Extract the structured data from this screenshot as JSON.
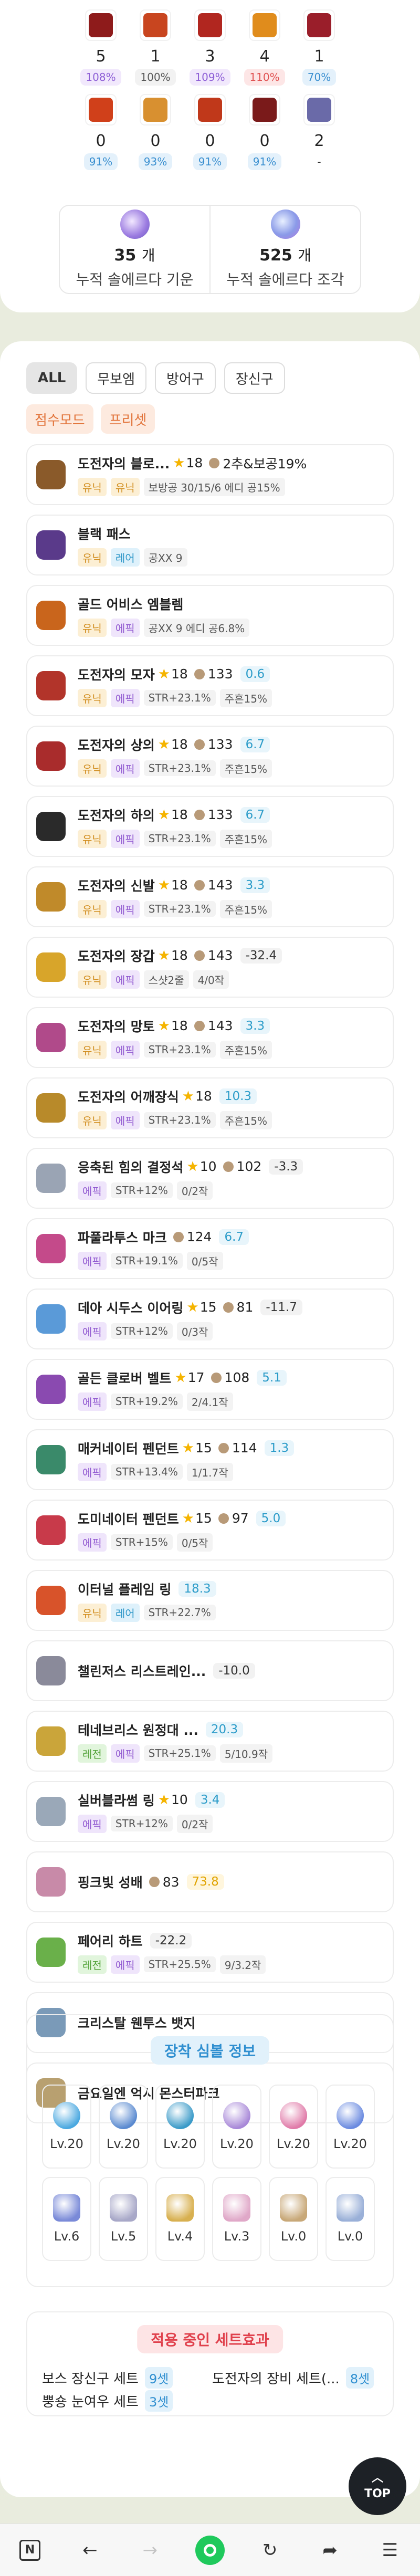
{
  "stats": [
    {
      "count": "5",
      "pct": "108%",
      "pct_color": "#8e5fd6",
      "pct_bg": "#f1e8fc",
      "icon_color": "#8e1b1b"
    },
    {
      "count": "1",
      "pct": "100%",
      "pct_color": "#555555",
      "pct_bg": "#f2f2f2",
      "icon_color": "#c8451f"
    },
    {
      "count": "3",
      "pct": "109%",
      "pct_color": "#8e5fd6",
      "pct_bg": "#f1e8fc",
      "icon_color": "#b1261f"
    },
    {
      "count": "4",
      "pct": "110%",
      "pct_color": "#e05050",
      "pct_bg": "#fde6e6",
      "icon_color": "#e08c1c"
    },
    {
      "count": "1",
      "pct": "70%",
      "pct_color": "#3a8fd0",
      "pct_bg": "#e4f1fb",
      "icon_color": "#9a1e2a"
    },
    {
      "count": "0",
      "pct": "91%",
      "pct_color": "#3a8fd0",
      "pct_bg": "#e4f1fb",
      "icon_color": "#d0401a"
    },
    {
      "count": "0",
      "pct": "93%",
      "pct_color": "#3a8fd0",
      "pct_bg": "#e4f1fb",
      "icon_color": "#d89030"
    },
    {
      "count": "0",
      "pct": "91%",
      "pct_color": "#3a8fd0",
      "pct_bg": "#e4f1fb",
      "icon_color": "#c0381a"
    },
    {
      "count": "0",
      "pct": "91%",
      "pct_color": "#3a8fd0",
      "pct_bg": "#e4f1fb",
      "icon_color": "#7a1a1a"
    },
    {
      "count": "2",
      "pct": "-",
      "pct_color": "#333333",
      "pct_bg": "#ffffff",
      "icon_color": "#6a6aa8"
    }
  ],
  "sol_erda": {
    "energy_num": "35",
    "energy_unit": "개",
    "energy_label": "누적 솔에르다 기운",
    "fragment_num": "525",
    "fragment_unit": "개",
    "fragment_label": "누적 솔에르다 조각"
  },
  "filters": [
    "ALL",
    "무보엠",
    "방어구",
    "장신구"
  ],
  "modes": [
    "점수모드",
    "프리셋"
  ],
  "items": [
    {
      "name": "도전자의 블로...",
      "icon": "#8a5a2a",
      "star": "18",
      "hammer": "",
      "diff": "",
      "extra": "2추&보공19%",
      "tags": [
        {
          "t": "유닉",
          "c": "unique"
        },
        {
          "t": "유닉",
          "c": "unique"
        },
        {
          "t": "보방공 30/15/6 에디 공15%",
          "c": "plain"
        }
      ]
    },
    {
      "name": "블랙 패스",
      "icon": "#5a3a8a",
      "star": "",
      "hammer": "",
      "diff": "",
      "extra": "",
      "tags": [
        {
          "t": "유닉",
          "c": "unique"
        },
        {
          "t": "레어",
          "c": "rare"
        },
        {
          "t": "공XX 9",
          "c": "plain"
        }
      ]
    },
    {
      "name": "골드 어비스 엠블렘",
      "icon": "#c9651c",
      "star": "",
      "hammer": "",
      "diff": "",
      "extra": "",
      "tags": [
        {
          "t": "유닉",
          "c": "unique"
        },
        {
          "t": "에픽",
          "c": "epic"
        },
        {
          "t": "공XX 9 에디 공6.8%",
          "c": "plain"
        }
      ]
    },
    {
      "name": "도전자의 모자",
      "icon": "#b2342a",
      "star": "18",
      "hammer": "133",
      "diff": "0.6",
      "diff_type": "pos",
      "extra": "",
      "tags": [
        {
          "t": "유닉",
          "c": "unique"
        },
        {
          "t": "에픽",
          "c": "epic"
        },
        {
          "t": "STR+23.1%",
          "c": "plain"
        },
        {
          "t": "주흔15%",
          "c": "plain"
        }
      ]
    },
    {
      "name": "도전자의 상의",
      "icon": "#a92c2c",
      "star": "18",
      "hammer": "133",
      "diff": "6.7",
      "diff_type": "pos",
      "extra": "",
      "tags": [
        {
          "t": "유닉",
          "c": "unique"
        },
        {
          "t": "에픽",
          "c": "epic"
        },
        {
          "t": "STR+23.1%",
          "c": "plain"
        },
        {
          "t": "주흔15%",
          "c": "plain"
        }
      ]
    },
    {
      "name": "도전자의 하의",
      "icon": "#2a2a2a",
      "star": "18",
      "hammer": "133",
      "diff": "6.7",
      "diff_type": "pos",
      "extra": "",
      "tags": [
        {
          "t": "유닉",
          "c": "unique"
        },
        {
          "t": "에픽",
          "c": "epic"
        },
        {
          "t": "STR+23.1%",
          "c": "plain"
        },
        {
          "t": "주흔15%",
          "c": "plain"
        }
      ]
    },
    {
      "name": "도전자의 신발",
      "icon": "#c08a2a",
      "star": "18",
      "hammer": "143",
      "diff": "3.3",
      "diff_type": "pos",
      "extra": "",
      "tags": [
        {
          "t": "유닉",
          "c": "unique"
        },
        {
          "t": "에픽",
          "c": "epic"
        },
        {
          "t": "STR+23.1%",
          "c": "plain"
        },
        {
          "t": "주흔15%",
          "c": "plain"
        }
      ]
    },
    {
      "name": "도전자의 장갑",
      "icon": "#d8a52a",
      "star": "18",
      "hammer": "143",
      "diff": "-32.4",
      "diff_type": "neg",
      "extra": "",
      "tags": [
        {
          "t": "유닉",
          "c": "unique"
        },
        {
          "t": "에픽",
          "c": "epic"
        },
        {
          "t": "스샷2줄",
          "c": "plain"
        },
        {
          "t": "4/0작",
          "c": "plain"
        }
      ]
    },
    {
      "name": "도전자의 망토",
      "icon": "#b04a8a",
      "star": "18",
      "hammer": "143",
      "diff": "3.3",
      "diff_type": "pos",
      "extra": "",
      "tags": [
        {
          "t": "유닉",
          "c": "unique"
        },
        {
          "t": "에픽",
          "c": "epic"
        },
        {
          "t": "STR+23.1%",
          "c": "plain"
        },
        {
          "t": "주흔15%",
          "c": "plain"
        }
      ]
    },
    {
      "name": "도전자의 어깨장식",
      "icon": "#b88a2a",
      "star": "18",
      "hammer": "",
      "diff": "10.3",
      "diff_type": "pos",
      "extra": "",
      "tags": [
        {
          "t": "유닉",
          "c": "unique"
        },
        {
          "t": "에픽",
          "c": "epic"
        },
        {
          "t": "STR+23.1%",
          "c": "plain"
        },
        {
          "t": "주흔15%",
          "c": "plain"
        }
      ]
    },
    {
      "name": "응축된 힘의 결정석",
      "icon": "#9aa4b4",
      "star": "10",
      "hammer": "102",
      "diff": "-3.3",
      "diff_type": "neg",
      "extra": "",
      "tags": [
        {
          "t": "에픽",
          "c": "epic"
        },
        {
          "t": "STR+12%",
          "c": "plain"
        },
        {
          "t": "0/2작",
          "c": "plain"
        }
      ]
    },
    {
      "name": "파풀라투스 마크",
      "icon": "#c44a8a",
      "star": "",
      "hammer": "124",
      "diff": "6.7",
      "diff_type": "pos",
      "extra": "",
      "tags": [
        {
          "t": "에픽",
          "c": "epic"
        },
        {
          "t": "STR+19.1%",
          "c": "plain"
        },
        {
          "t": "0/5작",
          "c": "plain"
        }
      ]
    },
    {
      "name": "데아 시두스 이어링",
      "icon": "#5a9ad8",
      "star": "15",
      "hammer": "81",
      "diff": "-11.7",
      "diff_type": "neg",
      "extra": "",
      "tags": [
        {
          "t": "에픽",
          "c": "epic"
        },
        {
          "t": "STR+12%",
          "c": "plain"
        },
        {
          "t": "0/3작",
          "c": "plain"
        }
      ]
    },
    {
      "name": "골든 클로버 벨트",
      "icon": "#8a4ab0",
      "star": "17",
      "hammer": "108",
      "diff": "5.1",
      "diff_type": "pos",
      "extra": "",
      "tags": [
        {
          "t": "에픽",
          "c": "epic"
        },
        {
          "t": "STR+19.2%",
          "c": "plain"
        },
        {
          "t": "2/4.1작",
          "c": "plain"
        }
      ]
    },
    {
      "name": "매커네이터 펜던트",
      "icon": "#3a8a6a",
      "star": "15",
      "hammer": "114",
      "diff": "1.3",
      "diff_type": "pos",
      "extra": "",
      "tags": [
        {
          "t": "에픽",
          "c": "epic"
        },
        {
          "t": "STR+13.4%",
          "c": "plain"
        },
        {
          "t": "1/1.7작",
          "c": "plain"
        }
      ]
    },
    {
      "name": "도미네이터 펜던트",
      "icon": "#c83a4a",
      "star": "15",
      "hammer": "97",
      "diff": "5.0",
      "diff_type": "pos",
      "extra": "",
      "tags": [
        {
          "t": "에픽",
          "c": "epic"
        },
        {
          "t": "STR+15%",
          "c": "plain"
        },
        {
          "t": "0/5작",
          "c": "plain"
        }
      ]
    },
    {
      "name": "이터널 플레임 링",
      "icon": "#d8532a",
      "star": "",
      "hammer": "",
      "diff": "18.3",
      "diff_type": "pos",
      "extra": "",
      "tags": [
        {
          "t": "유닉",
          "c": "unique"
        },
        {
          "t": "레어",
          "c": "rare"
        },
        {
          "t": "STR+22.7%",
          "c": "plain"
        }
      ]
    },
    {
      "name": "챌린저스 리스트레인...",
      "icon": "#8a8a9a",
      "star": "",
      "hammer": "",
      "diff": "-10.0",
      "diff_type": "neg",
      "extra": "",
      "tags": []
    },
    {
      "name": "테네브리스 원정대 ...",
      "icon": "#caa53a",
      "star": "",
      "hammer": "",
      "diff": "20.3",
      "diff_type": "pos",
      "extra": "",
      "tags": [
        {
          "t": "레전",
          "c": "legend"
        },
        {
          "t": "에픽",
          "c": "epic"
        },
        {
          "t": "STR+25.1%",
          "c": "plain"
        },
        {
          "t": "5/10.9작",
          "c": "plain"
        }
      ]
    },
    {
      "name": "실버블라썸 링",
      "icon": "#9aa8b8",
      "star": "10",
      "hammer": "",
      "diff": "3.4",
      "diff_type": "pos",
      "extra": "",
      "tags": [
        {
          "t": "에픽",
          "c": "epic"
        },
        {
          "t": "STR+12%",
          "c": "plain"
        },
        {
          "t": "0/2작",
          "c": "plain"
        }
      ]
    },
    {
      "name": "핑크빛 성배",
      "icon": "#c88aa8",
      "star": "",
      "hammer": "83",
      "diff": "73.8",
      "diff_type": "gold",
      "extra": "",
      "tags": []
    },
    {
      "name": "페어리 하트",
      "icon": "#6ab04a",
      "star": "",
      "hammer": "",
      "diff": "-22.2",
      "diff_type": "neg",
      "extra": "",
      "tags": [
        {
          "t": "레전",
          "c": "legend"
        },
        {
          "t": "에픽",
          "c": "epic"
        },
        {
          "t": "STR+25.5%",
          "c": "plain"
        },
        {
          "t": "9/3.2작",
          "c": "plain"
        }
      ]
    },
    {
      "name": "크리스탈 웬투스 뱃지",
      "icon": "#7a9ab8",
      "star": "",
      "hammer": "",
      "diff": "",
      "extra": "",
      "tags": []
    },
    {
      "name": "금요일엔 억시 몬스터파크",
      "icon": "#b8a070",
      "star": "",
      "hammer": "",
      "diff": "",
      "extra": "",
      "tags": []
    }
  ],
  "symbols": {
    "title": "장착 심볼 정보",
    "list": [
      {
        "lv": "Lv.20",
        "color": "#4aa8e0",
        "shape": "round"
      },
      {
        "lv": "Lv.20",
        "color": "#5a8ad0",
        "shape": "round"
      },
      {
        "lv": "Lv.20",
        "color": "#3a9ac8",
        "shape": "round"
      },
      {
        "lv": "Lv.20",
        "color": "#a888d8",
        "shape": "round"
      },
      {
        "lv": "Lv.20",
        "color": "#e07aa8",
        "shape": "round"
      },
      {
        "lv": "Lv.20",
        "color": "#6a8ae0",
        "shape": "round"
      },
      {
        "lv": "Lv.6",
        "color": "#7a8ad8",
        "shape": "sq"
      },
      {
        "lv": "Lv.5",
        "color": "#a8a8c8",
        "shape": "sq"
      },
      {
        "lv": "Lv.4",
        "color": "#d8b050",
        "shape": "sq"
      },
      {
        "lv": "Lv.3",
        "color": "#e0a8c8",
        "shape": "sq"
      },
      {
        "lv": "Lv.0",
        "color": "#c8a878",
        "shape": "sq"
      },
      {
        "lv": "Lv.0",
        "color": "#9ab0d8",
        "shape": "sq"
      }
    ]
  },
  "set_effects": {
    "title": "적용 중인 세트효과",
    "rows": [
      {
        "name": "보스 장신구 세트",
        "count": "9셋"
      },
      {
        "name": "도전자의 장비 세트(...",
        "count": "8셋"
      },
      {
        "name": "뿡숑 눈여우 세트",
        "count": "3셋"
      }
    ]
  },
  "top_button": "TOP",
  "bottom_nav": {
    "n_label": "N"
  }
}
